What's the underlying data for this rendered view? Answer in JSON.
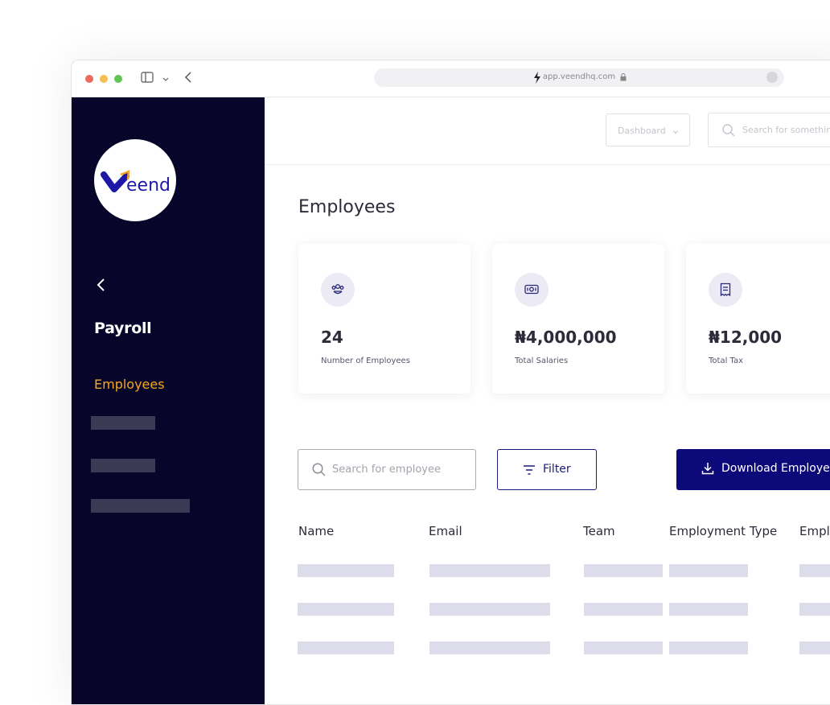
{
  "browser": {
    "url": "app.veendhq.com",
    "traffic_colors": [
      "#ec6a5e",
      "#f4bf4f",
      "#61c554"
    ]
  },
  "sidebar": {
    "logo_text": "eend",
    "section_title": "Payroll",
    "active_item": "Employees",
    "active_color": "#f5a623"
  },
  "topbar": {
    "dashboard_select": "Dashboard",
    "search_placeholder": "Search for something"
  },
  "page": {
    "title": "Employees"
  },
  "stats": [
    {
      "value": "24",
      "label": "Number of Employees",
      "icon": "people-icon"
    },
    {
      "value": "₦4,000,000",
      "label": "Total Salaries",
      "icon": "cash-icon"
    },
    {
      "value": "₦12,000",
      "label": "Total Tax",
      "icon": "receipt-icon"
    }
  ],
  "toolbar": {
    "search_placeholder": "Search for employee",
    "filter_label": "Filter",
    "download_label": "Download Employees"
  },
  "table": {
    "columns": [
      "Name",
      "Email",
      "Team",
      "Employment Type",
      "Employment"
    ]
  },
  "colors": {
    "sidebar_bg": "#07062a",
    "primary": "#0c0a7a",
    "placeholder_bar": "#dcdcea"
  }
}
